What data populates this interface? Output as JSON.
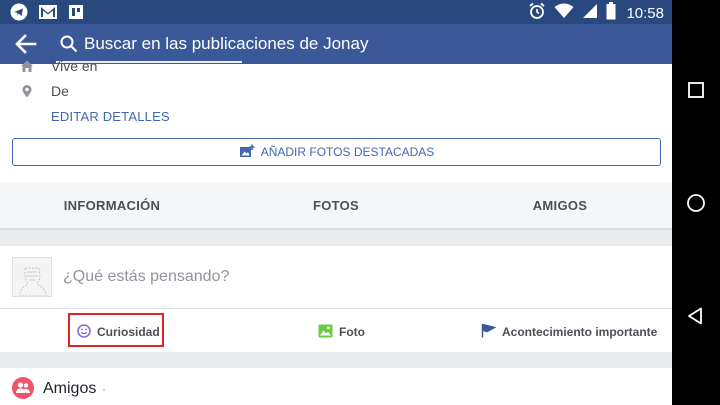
{
  "status_bar": {
    "time": "10:58",
    "left_icons": [
      "telegram-icon",
      "gmail-icon",
      "gallery-icon"
    ],
    "right_icons": [
      "alarm-icon",
      "wifi-icon",
      "signal-icon",
      "battery-icon"
    ]
  },
  "app_bar": {
    "back_icon": "back-arrow-icon",
    "search_icon": "search-icon",
    "search_text": "Buscar en las publicaciones de Jonay"
  },
  "profile_details": {
    "items": [
      {
        "icon": "home-icon",
        "label": "Vive en"
      },
      {
        "icon": "location-pin-icon",
        "label": "De"
      }
    ],
    "edit_label": "EDITAR DETALLES",
    "add_photos_label": "AÑADIR FOTOS DESTACADAS"
  },
  "tabs": [
    {
      "label": "INFORMACIÓN"
    },
    {
      "label": "FOTOS"
    },
    {
      "label": "AMIGOS"
    }
  ],
  "composer": {
    "placeholder": "¿Qué estás pensando?",
    "actions": [
      {
        "label": "Curiosidad",
        "icon": "smiley-icon"
      },
      {
        "label": "Foto",
        "icon": "photo-icon"
      },
      {
        "label": "Acontecimiento importante",
        "icon": "flag-icon"
      }
    ]
  },
  "friends_section": {
    "label": "Amigos",
    "separator": "·"
  },
  "colors": {
    "fb_blue": "#3b5998",
    "status_bar": "#29487d",
    "link_blue": "#4267b2",
    "highlight_red": "#e02424"
  },
  "nav_bar": {
    "buttons": [
      "recents-square-icon",
      "home-circle-icon",
      "back-triangle-icon"
    ]
  }
}
